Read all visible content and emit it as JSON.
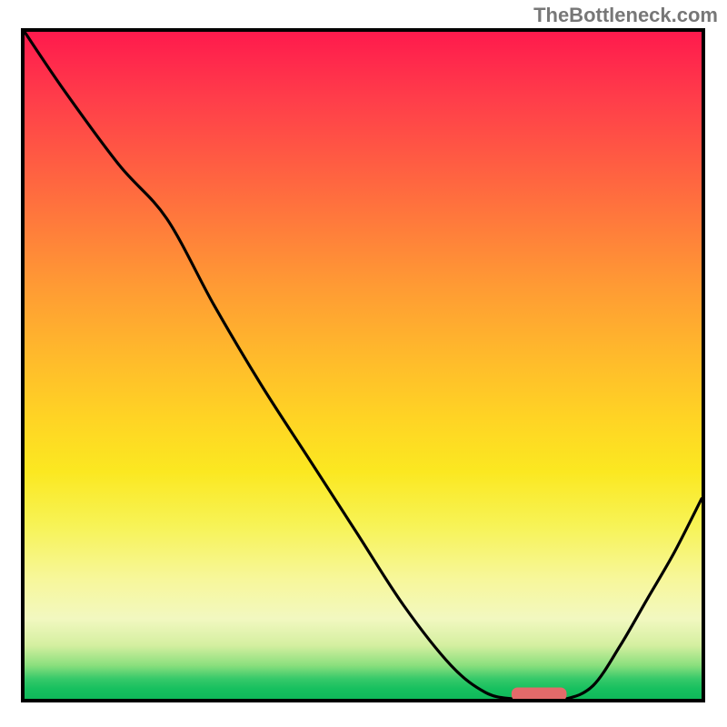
{
  "watermark": "TheBottleneck.com",
  "chart_data": {
    "type": "line",
    "title": "",
    "xlabel": "",
    "ylabel": "",
    "xlim": [
      0,
      100
    ],
    "ylim": [
      0,
      100
    ],
    "gradient_stops": [
      {
        "pos": 0,
        "color": "#ff1a4d"
      },
      {
        "pos": 10,
        "color": "#ff3d4a"
      },
      {
        "pos": 24,
        "color": "#ff6b3f"
      },
      {
        "pos": 38,
        "color": "#ff9a34"
      },
      {
        "pos": 48,
        "color": "#ffb82c"
      },
      {
        "pos": 58,
        "color": "#ffd424"
      },
      {
        "pos": 66,
        "color": "#fbe821"
      },
      {
        "pos": 74,
        "color": "#f7f356"
      },
      {
        "pos": 82,
        "color": "#f7f79a"
      },
      {
        "pos": 88,
        "color": "#f2f8c0"
      },
      {
        "pos": 92,
        "color": "#d4efa0"
      },
      {
        "pos": 95,
        "color": "#8adf7d"
      },
      {
        "pos": 97,
        "color": "#36c96a"
      },
      {
        "pos": 98.5,
        "color": "#17c05f"
      },
      {
        "pos": 100,
        "color": "#0fb95a"
      }
    ],
    "series": [
      {
        "name": "bottleneck-curve",
        "x": [
          0,
          6,
          14,
          21,
          28,
          35,
          42,
          49,
          56,
          63,
          68,
          72,
          76,
          80,
          84,
          88,
          92,
          96,
          100
        ],
        "y": [
          100,
          91,
          80,
          72,
          59,
          47,
          36,
          25,
          14,
          5,
          1,
          0,
          0,
          0,
          2,
          8,
          15,
          22,
          30
        ]
      }
    ],
    "marker": {
      "x_start": 72,
      "x_end": 80,
      "y": 0,
      "color": "#e36a6a"
    }
  }
}
